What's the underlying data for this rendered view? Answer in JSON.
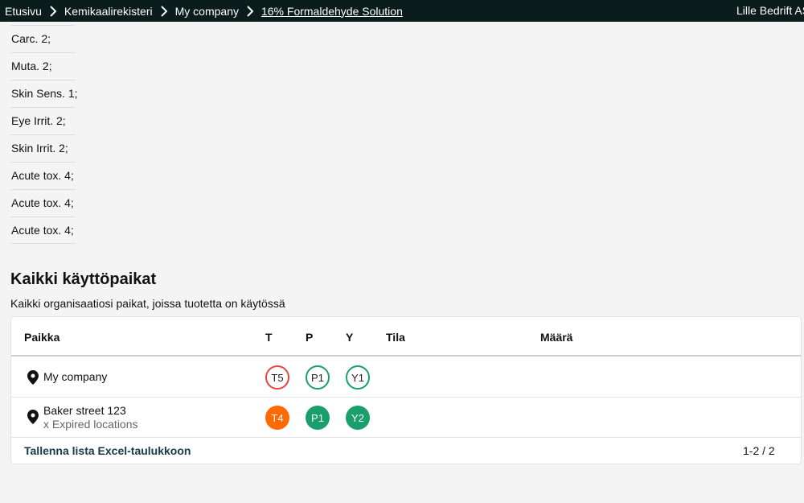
{
  "breadcrumb": {
    "items": [
      "Etusivu",
      "Kemikaalirekisteri",
      "My company",
      "16% Formaldehyde Solution"
    ],
    "organization": "Lille Bedrift AS"
  },
  "hazard_classes": [
    "Carc. 2;",
    "Muta. 2;",
    "Skin Sens. 1;",
    "Eye Irrit. 2;",
    "Skin Irrit. 2;",
    "Acute tox. 4;",
    "Acute tox. 4;",
    "Acute tox. 4;"
  ],
  "locations_section": {
    "title": "Kaikki käyttöpaikat",
    "subtitle": "Kaikki organisaatiosi paikat, joissa tuotetta on käytössä",
    "columns": {
      "place": "Paikka",
      "t": "T",
      "p": "P",
      "y": "Y",
      "status": "Tila",
      "amount": "Määrä"
    },
    "rows": [
      {
        "place": "My company",
        "sub": "",
        "t": "T5",
        "p": "P1",
        "y": "Y1"
      },
      {
        "place": "Baker street 123",
        "sub": "x Expired locations",
        "t": "T4",
        "p": "P1",
        "y": "Y2"
      }
    ],
    "export_label": "Tallenna lista Excel-taulukkoon",
    "pagination": "1-2 / 2"
  },
  "colors": {
    "topbar": "#0a1c1c",
    "red": "#e8453c",
    "green": "#1a9e6b",
    "orange": "#ff6a00"
  },
  "icons": {
    "separator": "chevron-right-icon",
    "location": "map-pin-icon"
  }
}
